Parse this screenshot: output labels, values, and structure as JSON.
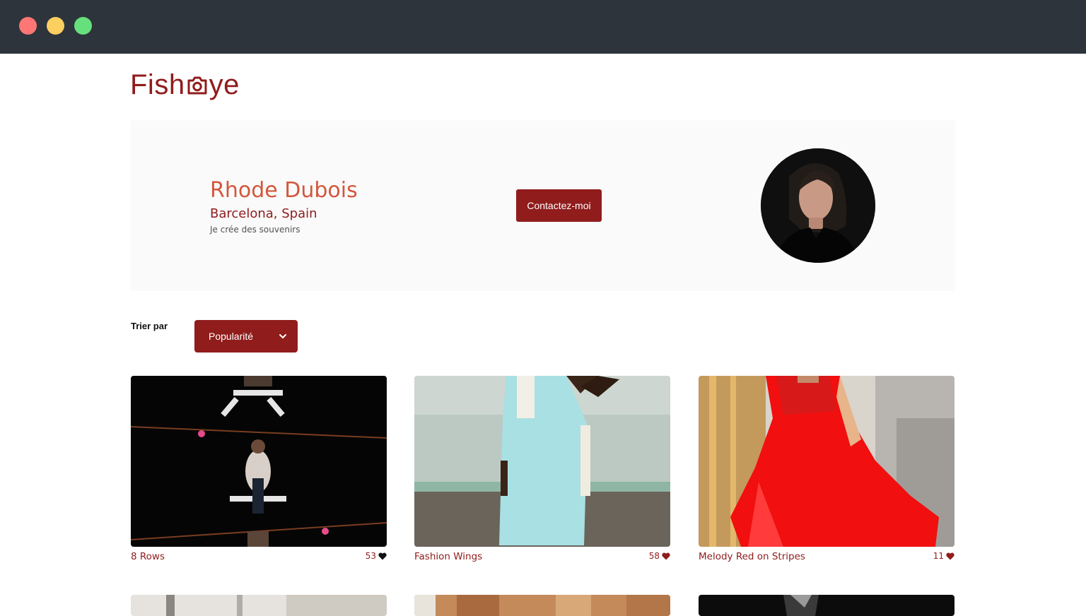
{
  "window": {
    "controls": [
      "close",
      "minimize",
      "maximize"
    ]
  },
  "brand": {
    "logo_left": "Fish",
    "logo_right": "ye",
    "logo_icon": "camera-icon",
    "color": "#901c1c"
  },
  "photographer": {
    "name": "Rhode Dubois",
    "location": "Barcelona, Spain",
    "tagline": "Je crée des souvenirs"
  },
  "contact": {
    "label": "Contactez-moi"
  },
  "sort": {
    "label": "Trier par",
    "selected": "Popularité"
  },
  "gallery": [
    {
      "title": "8 Rows",
      "likes": "53"
    },
    {
      "title": "Fashion Wings",
      "likes": "58"
    },
    {
      "title": "Melody Red on Stripes",
      "likes": "11"
    }
  ],
  "colors": {
    "accent": "#901c1c",
    "name": "#d3573c",
    "hero_bg": "#fafafa",
    "titlebar": "#2e343c"
  }
}
